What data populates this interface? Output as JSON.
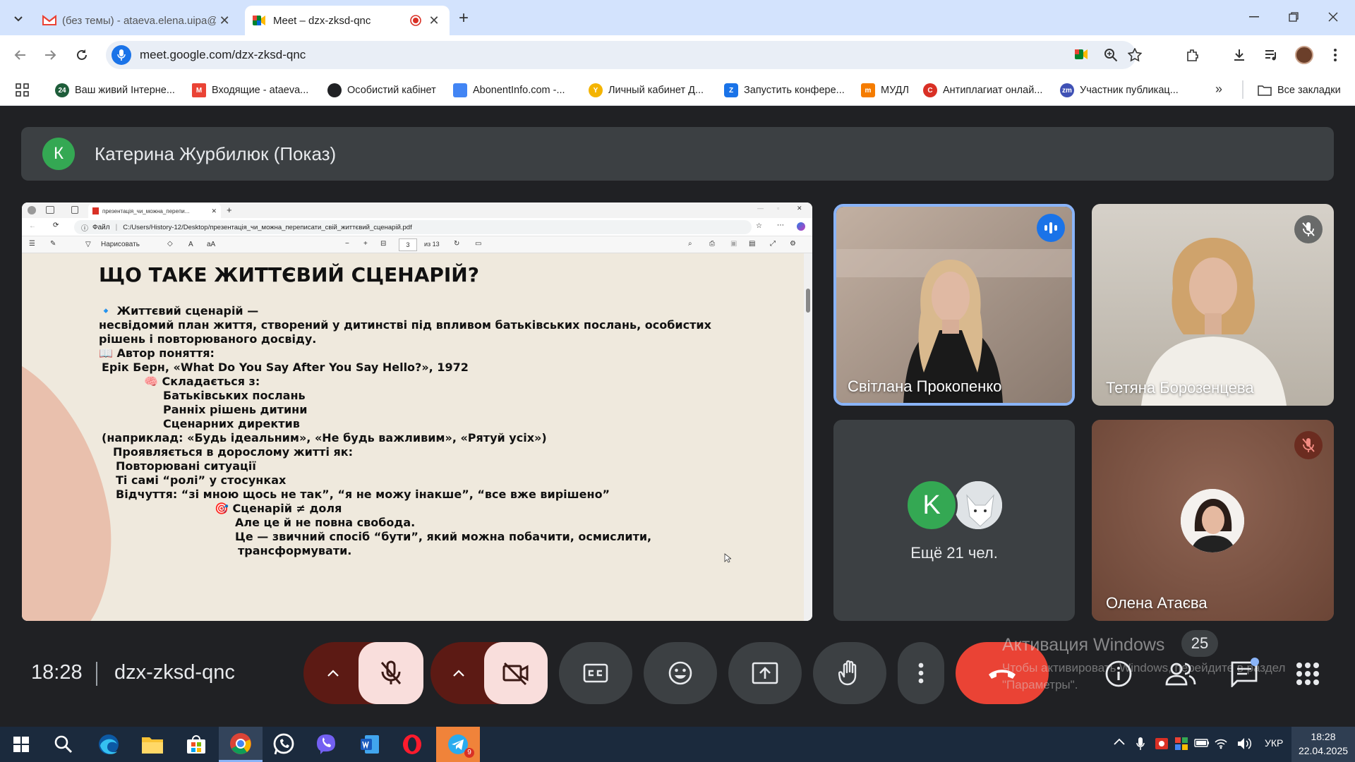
{
  "browser": {
    "tabs": [
      {
        "title": "(без темы) - ataeva.elena.uipa@",
        "icon": "gmail-icon"
      },
      {
        "title": "Meet – dzx-zksd-qnc",
        "icon": "meet-icon",
        "recording": true
      }
    ],
    "url": "meet.google.com/dzx-zksd-qnc",
    "bookmarks": [
      {
        "label": "Ваш живий Інтерне...",
        "icon": "24",
        "color": "#1e5d3a"
      },
      {
        "label": "Входящие - ataeva...",
        "icon": "M",
        "color": "#ea4335"
      },
      {
        "label": "Особистий кабінет",
        "icon": "",
        "color": "#202124"
      },
      {
        "label": "AbonentInfo.com -...",
        "icon": "",
        "color": "#4285f4"
      },
      {
        "label": "Личный кабинет Д...",
        "icon": "Y",
        "color": "#f4b400"
      },
      {
        "label": "Запустить конфере...",
        "icon": "Z",
        "color": "#1a73e8"
      },
      {
        "label": "МУДЛ",
        "icon": "m",
        "color": "#f57c00"
      },
      {
        "label": "Антиплагиат онлай...",
        "icon": "C",
        "color": "#d93025"
      },
      {
        "label": "Участник публикац...",
        "icon": "zm",
        "color": "#3f51b5"
      }
    ],
    "all_bookmarks": "Все закладки"
  },
  "meet": {
    "presenter_initial": "К",
    "presenter_title": "Катерина Журбилюк (Показ)",
    "time": "18:28",
    "meeting_code": "dzx-zksd-qnc",
    "participants_count": "25",
    "more_people": "Ещё 21 чел.",
    "others_initial": "K",
    "tiles": [
      {
        "name": "Світлана Прокопенко",
        "speaking": true
      },
      {
        "name": "Тетяна Борозенцева",
        "muted": true
      },
      {
        "name": "Олена Атаєва",
        "muted": true
      }
    ]
  },
  "shared_screen": {
    "edge_tab": "презентація_чи_можна_перепи...",
    "file_label": "Файл",
    "path": "C:/Users/History-12/Desktop/презентація_чи_можна_переписати_свій_життєвий_сценарій.pdf",
    "draw_label": "Нарисовать",
    "page": "3",
    "page_total": "из 13",
    "slide": {
      "title": "ЩО ТАКЕ ЖИТТЄВИЙ СЦЕНАРІЙ?",
      "lines": [
        "🔹 Життєвий сценарій —",
        "несвідомий план життя, створений у дитинстві під впливом батьківських послань, особистих",
        "рішень і повторюваного досвіду.",
        "📖 Автор поняття:",
        "Ерік Берн, «What Do You Say After You Say Hello?», 1972",
        "🧠 Складається з:",
        "Батьківських послань",
        "Ранніх рішень дитини",
        "Сценарних директив",
        "(наприклад: «Будь ідеальним», «Не будь важливим», «Рятуй усіх»)",
        "Проявляється в дорослому житті як:",
        "Повторювані ситуації",
        "Ті самі “ролі” у стосунках",
        "Відчуття: “зі мною щось не так”, “я не можу інакше”, “все вже вирішено”",
        "🎯 Сценарій ≠ доля",
        "Але це й не повна свобода.",
        "Це — звичний спосіб “бути”, який можна побачити, осмислити,",
        "трансформувати."
      ]
    }
  },
  "windows_activation": {
    "title": "Активация Windows",
    "text": "Чтобы активировать Windows, перейдите в раздел \"Параметры\"."
  },
  "taskbar": {
    "lang": "УКР",
    "time": "18:28",
    "date": "22.04.2025",
    "telegram_badge": "9"
  },
  "colors": {
    "accent_blue": "#8ab4f8",
    "end_call_red": "#ea4335",
    "meet_bg": "#202124",
    "tile_bg": "#3c4043"
  }
}
